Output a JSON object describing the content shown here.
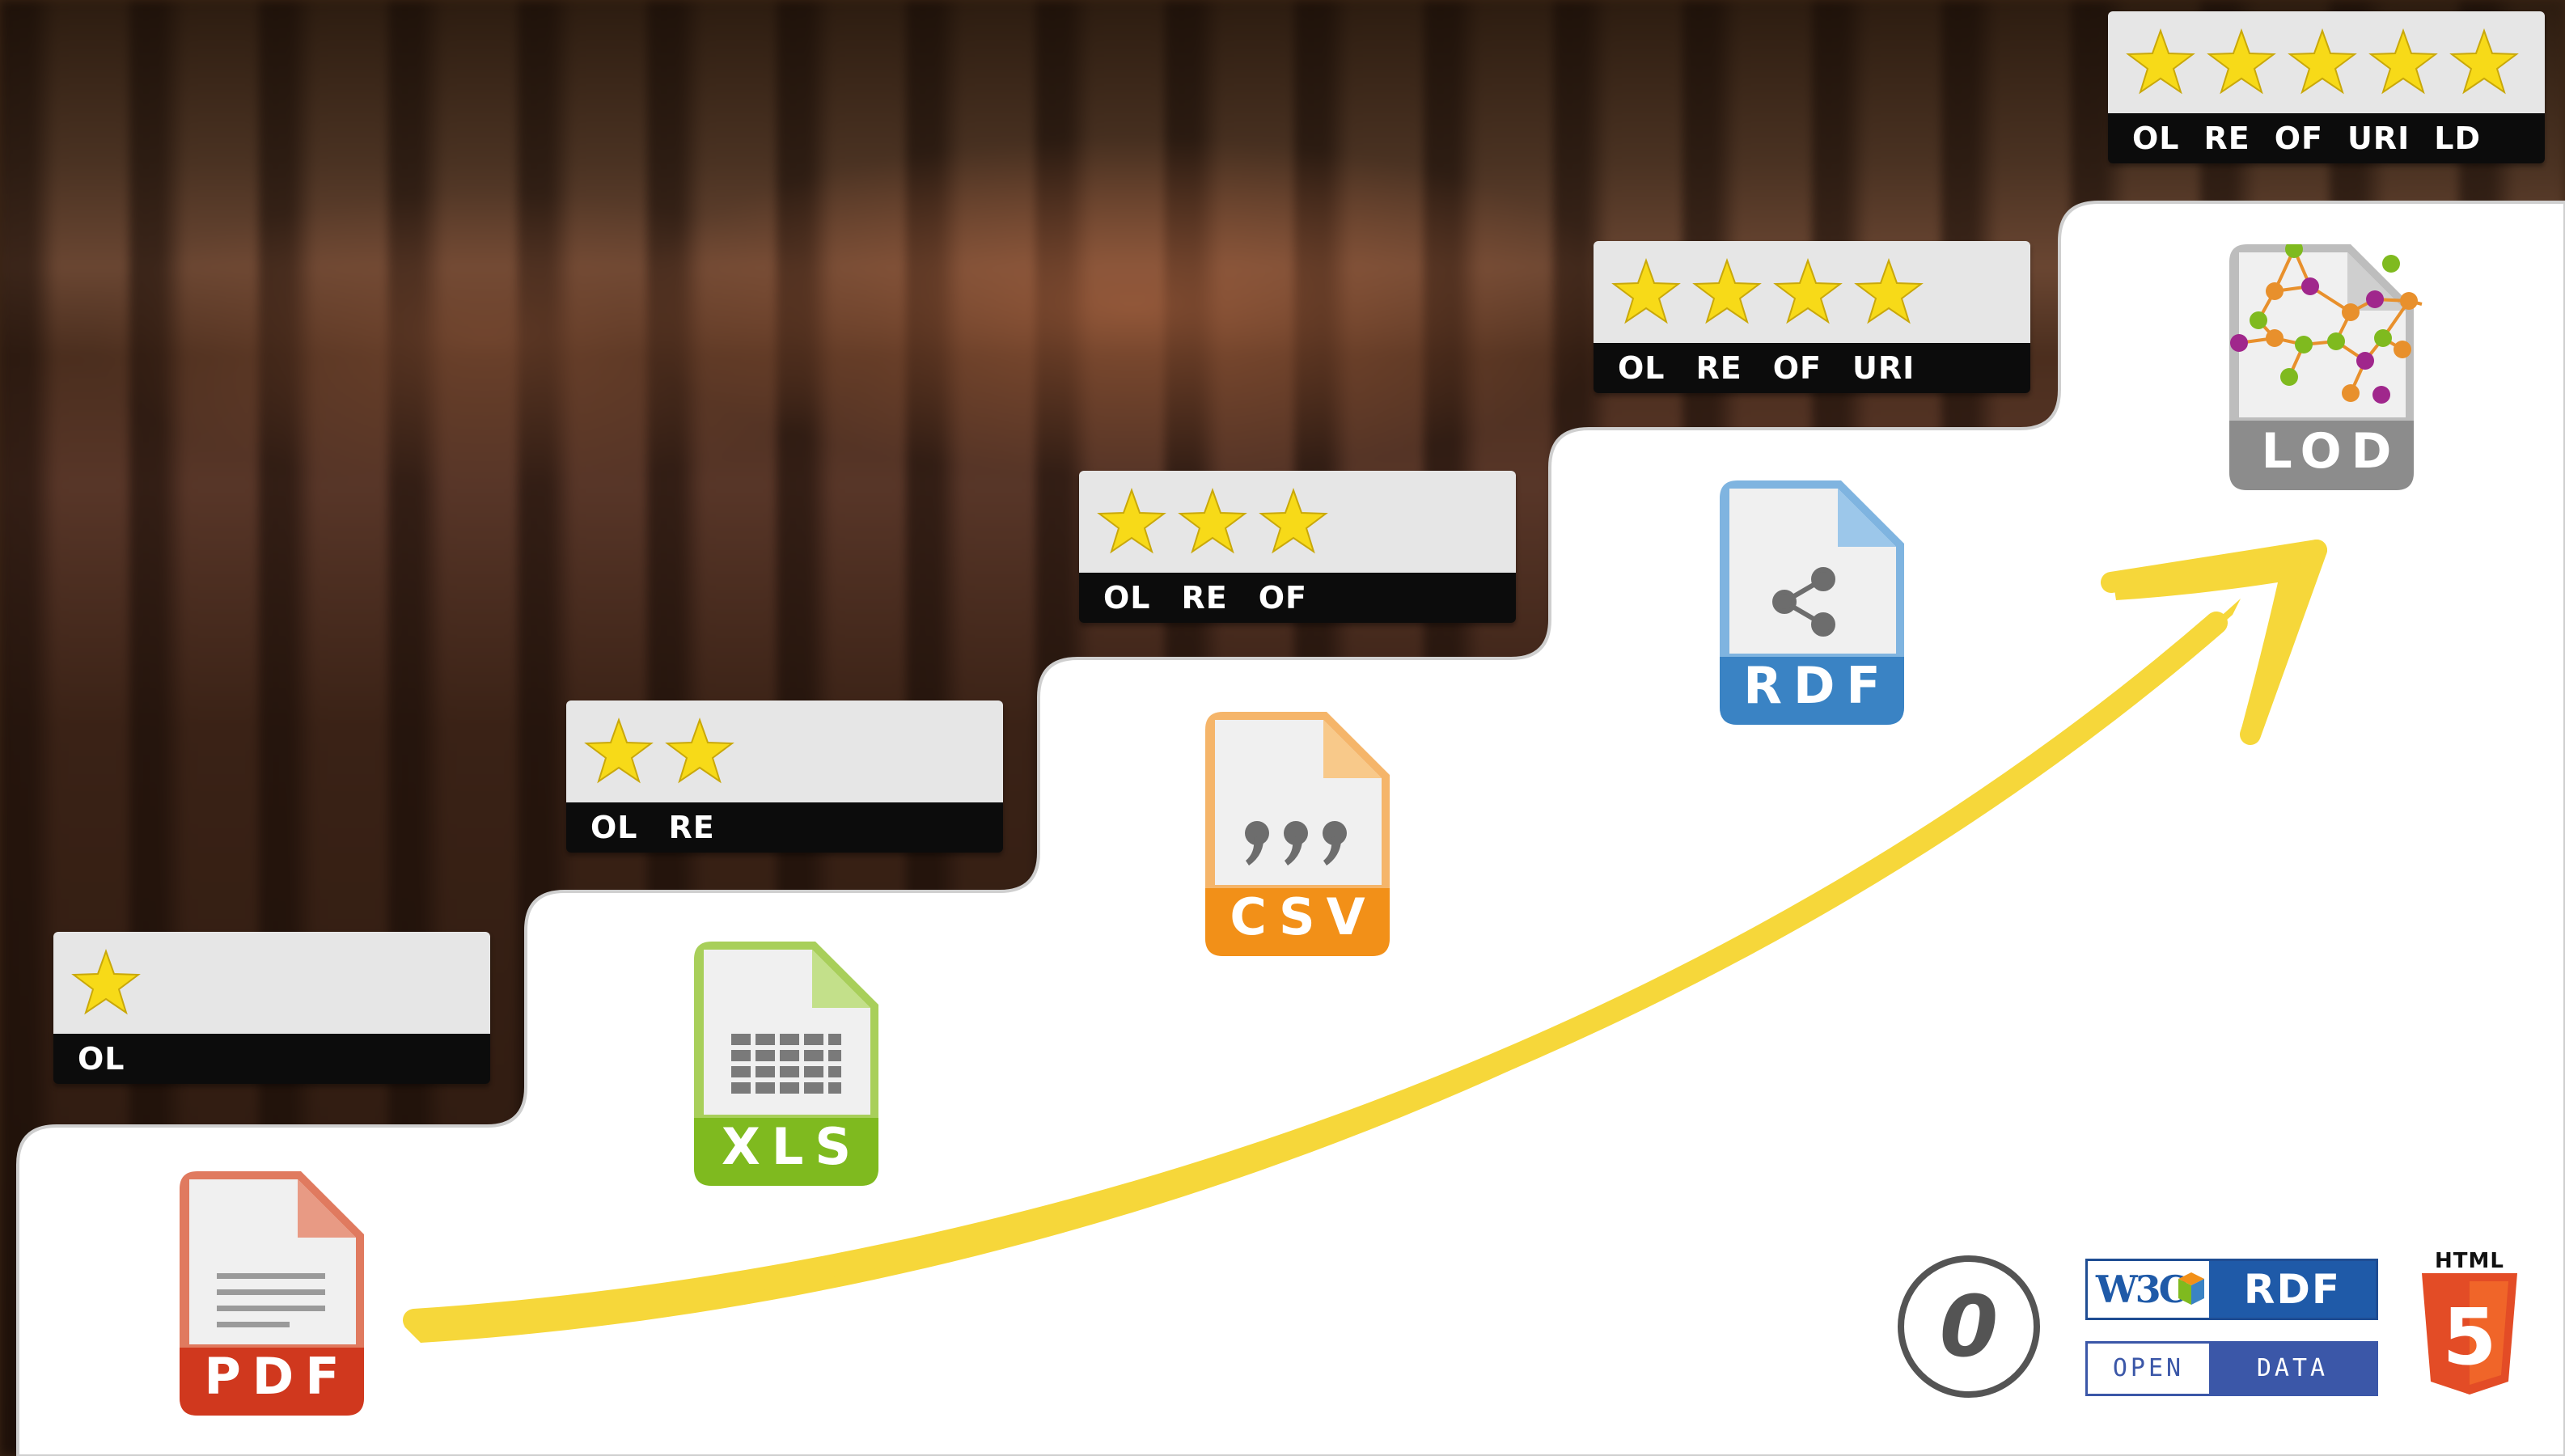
{
  "ratings": [
    {
      "stars": 1,
      "labels": [
        "OL"
      ]
    },
    {
      "stars": 2,
      "labels": [
        "OL",
        "RE"
      ]
    },
    {
      "stars": 3,
      "labels": [
        "OL",
        "RE",
        "OF"
      ]
    },
    {
      "stars": 4,
      "labels": [
        "OL",
        "RE",
        "OF",
        "URI"
      ]
    },
    {
      "stars": 5,
      "labels": [
        "OL",
        "RE",
        "OF",
        "URI",
        "LD"
      ]
    }
  ],
  "formats": {
    "pdf": {
      "label": "PDF",
      "color": "#d0381e",
      "light": "#ef9c84",
      "icon": "document-lines-icon"
    },
    "xls": {
      "label": "XLS",
      "color": "#7fba1f",
      "light": "#c3e08a",
      "icon": "spreadsheet-grid-icon"
    },
    "csv": {
      "label": "CSV",
      "color": "#f29018",
      "light": "#f8c98a",
      "icon": "quote-marks-icon"
    },
    "rdf": {
      "label": "RDF",
      "color": "#3a83c4",
      "light": "#9cc7ea",
      "icon": "share-graph-icon"
    },
    "lod": {
      "label": "LOD",
      "color": "#8c8c8c",
      "light": "#cfcfcf",
      "icon": "linked-network-icon"
    }
  },
  "colors": {
    "star": "#f7da18",
    "arrow": "#f6d73a",
    "step": "#ffffff"
  },
  "badges": {
    "cc0": "0",
    "w3c_left": "W3C",
    "w3c_right": "RDF",
    "opendata_left": "OPEN",
    "opendata_right": "DATA",
    "html5_label": "HTML",
    "html5_number": "5"
  }
}
